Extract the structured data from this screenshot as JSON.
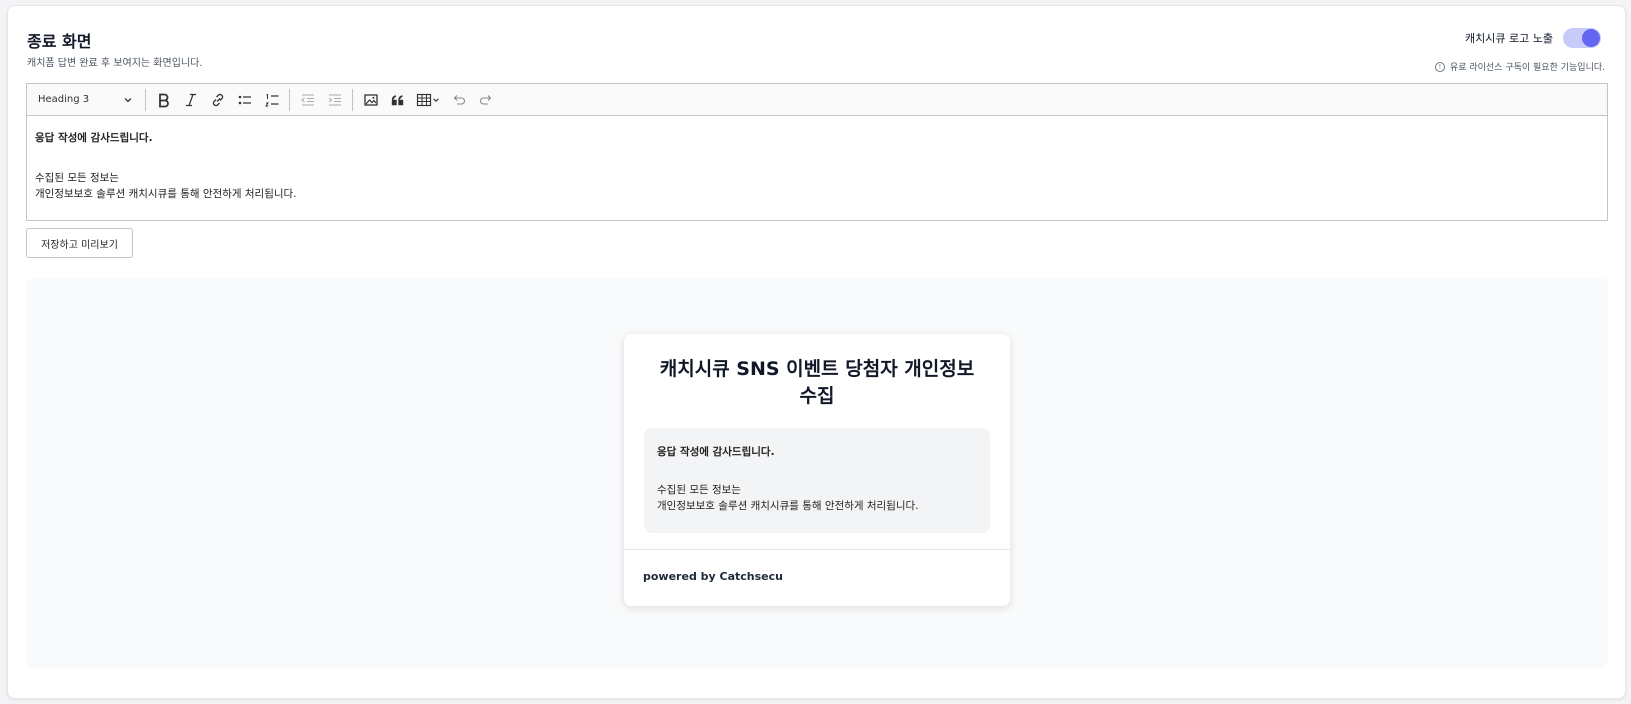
{
  "section": {
    "title": "종료 화면",
    "subtitle": "캐치폼 답변 완료 후 보여지는 화면입니다."
  },
  "logo_toggle": {
    "label": "캐치시큐 로고 노출",
    "enabled": true,
    "color": "#6366f1",
    "track_color": "#c7cbfa"
  },
  "license_notice": {
    "icon": "info-icon",
    "text": "유료 라이선스 구독이 필요한 기능입니다."
  },
  "editor": {
    "heading_select": "Heading 3",
    "toolbar_icons": [
      "bold-icon",
      "italic-icon",
      "link-icon",
      "bulleted-list-icon",
      "numbered-list-icon",
      "outdent-icon",
      "indent-icon",
      "image-icon",
      "quote-icon",
      "table-icon",
      "undo-icon",
      "redo-icon"
    ],
    "content": {
      "heading": "응답 작성에 감사드립니다.",
      "line1": "수집된 모든 정보는",
      "line2": "개인정보보호 솔루션 캐치시큐를 통해 안전하게 처리됩니다."
    }
  },
  "save_button": "저장하고 미리보기",
  "preview": {
    "title": "캐치시큐 SNS 이벤트 당첨자 개인정보 수집",
    "message": {
      "heading": "응답 작성에 감사드립니다.",
      "line1": "수집된 모든 정보는",
      "line2": "개인정보보호 솔루션 캐치시큐를 통해 안전하게 처리됩니다."
    },
    "footer": "powered by Catchsecu"
  }
}
